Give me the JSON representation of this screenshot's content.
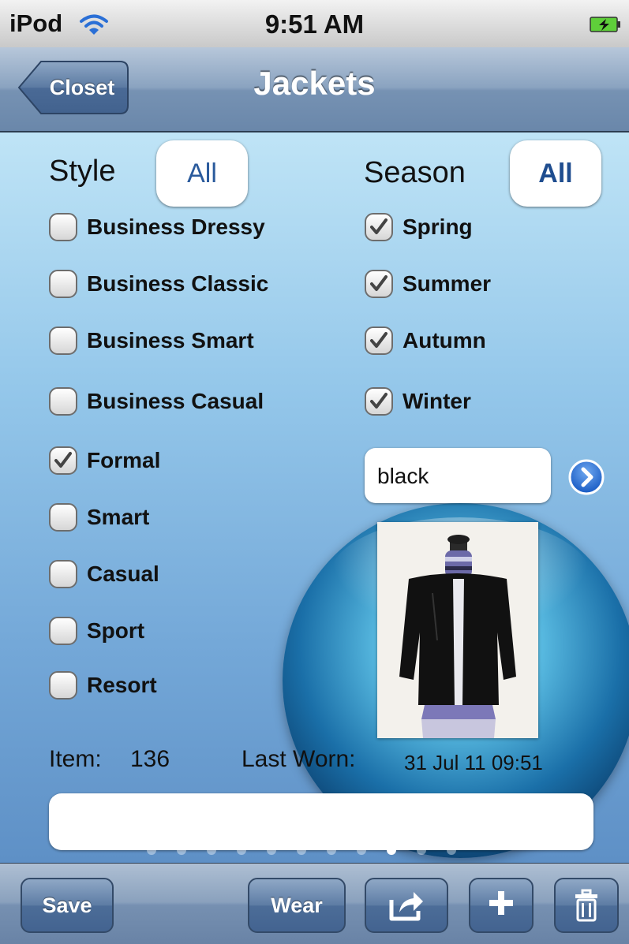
{
  "status_bar": {
    "carrier": "iPod",
    "time": "9:51 AM"
  },
  "nav": {
    "back_label": "Closet",
    "title": "Jackets"
  },
  "style": {
    "label": "Style",
    "all_button": "All",
    "options": [
      {
        "label": "Business Dressy",
        "checked": false
      },
      {
        "label": "Business Classic",
        "checked": false
      },
      {
        "label": "Business Smart",
        "checked": false
      },
      {
        "label": "Business Casual",
        "checked": false
      },
      {
        "label": "Formal",
        "checked": true
      },
      {
        "label": "Smart",
        "checked": false
      },
      {
        "label": "Casual",
        "checked": false
      },
      {
        "label": "Sport",
        "checked": false
      },
      {
        "label": "Resort",
        "checked": false
      }
    ]
  },
  "season": {
    "label": "Season",
    "all_button": "All",
    "options": [
      {
        "label": "Spring",
        "checked": true
      },
      {
        "label": "Summer",
        "checked": true
      },
      {
        "label": "Autumn",
        "checked": true
      },
      {
        "label": "Winter",
        "checked": true
      }
    ]
  },
  "color_field": {
    "value": "black"
  },
  "item": {
    "label": "Item:",
    "number": "136"
  },
  "last_worn": {
    "label": "Last Worn:",
    "value": "31 Jul 11 09:51"
  },
  "notes_field": {
    "value": ""
  },
  "page_control": {
    "total": 11,
    "current_index": 8
  },
  "toolbar": {
    "save_label": "Save",
    "wear_label": "Wear"
  },
  "icons": {
    "wifi": "wifi-icon",
    "battery": "battery-charging-icon",
    "go": "chevron-right-circle-icon",
    "share": "share-icon",
    "add": "plus-icon",
    "delete": "trash-icon"
  }
}
